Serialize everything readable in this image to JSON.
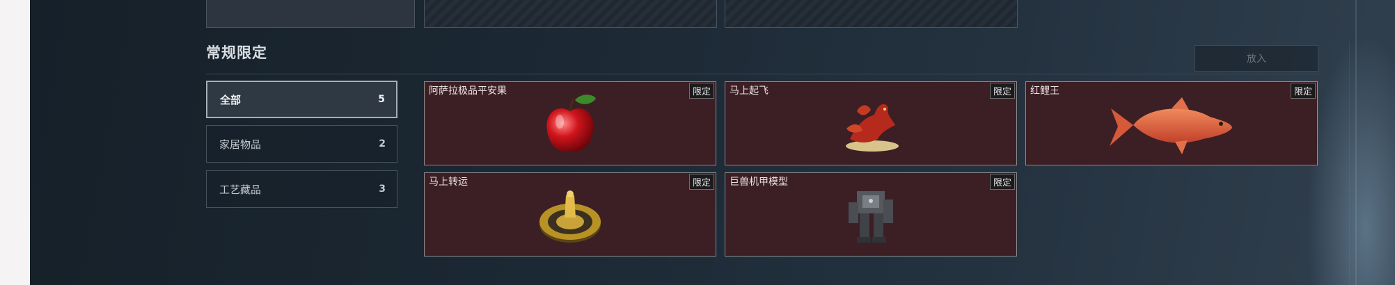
{
  "section": {
    "title": "常规限定",
    "put_button": "放入"
  },
  "categories": [
    {
      "label": "全部",
      "count": "5",
      "active": true
    },
    {
      "label": "家居物品",
      "count": "2",
      "active": false
    },
    {
      "label": "工艺藏品",
      "count": "3",
      "active": false
    }
  ],
  "items": [
    {
      "name": "阿萨拉极品平安果",
      "tag": "限定",
      "icon": "apple-icon"
    },
    {
      "name": "马上起飞",
      "tag": "限定",
      "icon": "flying-horse-icon"
    },
    {
      "name": "红鲤王",
      "tag": "限定",
      "icon": "red-carp-icon"
    },
    {
      "name": "马上转运",
      "tag": "限定",
      "icon": "golden-compass-icon"
    },
    {
      "name": "巨兽机甲模型",
      "tag": "限定",
      "icon": "mech-model-icon"
    }
  ],
  "colors": {
    "card_bg": "#3c1f24",
    "panel_bg": "#1b2732",
    "active_border": "#a7b0b9"
  }
}
